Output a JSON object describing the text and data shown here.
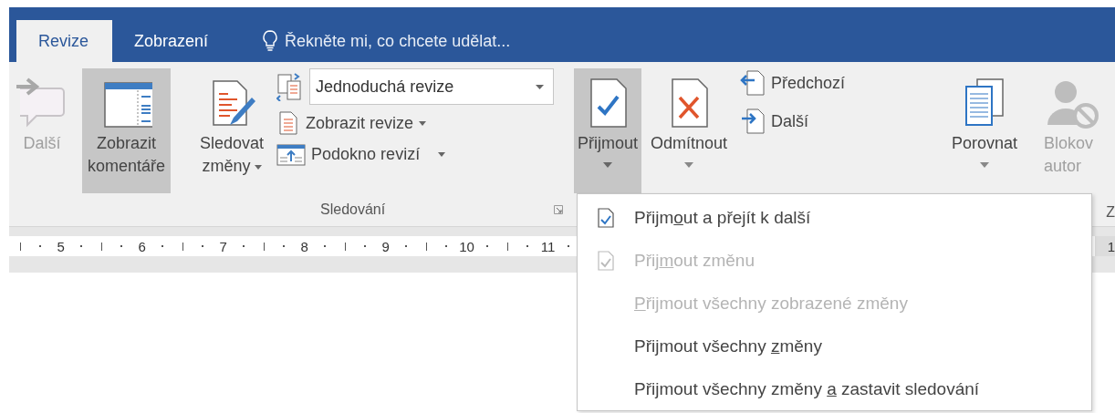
{
  "tabs": [
    {
      "label": "Revize",
      "selected": true
    },
    {
      "label": "Zobrazení",
      "selected": false
    }
  ],
  "tell_me": {
    "placeholder": "Řekněte mi, co chcete udělat..."
  },
  "ribbon": {
    "next_comment": {
      "label": "Další",
      "disabled": true
    },
    "show_comments": {
      "label_lines": [
        "Zobrazit",
        "komentáře"
      ],
      "selected": true
    },
    "track_changes": {
      "label_lines": [
        "Sledovat",
        "změny"
      ]
    },
    "markup_combo": {
      "value": "Jednoduchá revize"
    },
    "show_markup": {
      "label": "Zobrazit revize"
    },
    "reviewing_pane": {
      "label": "Podokno revizí"
    },
    "tracking_group": {
      "label": "Sledování"
    },
    "accept": {
      "label": "Přijmout",
      "selected": true
    },
    "reject": {
      "label": "Odmítnout",
      "selected": false
    },
    "previous": {
      "label": "Předchozí"
    },
    "next": {
      "label": "Další"
    },
    "compare": {
      "label": "Porovnat"
    },
    "block_authors": {
      "label_lines": [
        "Blokov",
        "autor"
      ],
      "disabled": true
    },
    "cut_group": {
      "label": "Z"
    }
  },
  "ruler": {
    "numbers": [
      "5",
      "6",
      "7",
      "8",
      "9",
      "10",
      "11"
    ],
    "cut_number": "1"
  },
  "accept_menu": [
    {
      "parts": [
        "Přijm",
        "o",
        "ut a přejít k další"
      ],
      "disabled": false,
      "kind": "check"
    },
    {
      "parts": [
        "Přij",
        "m",
        "out změnu"
      ],
      "disabled": true,
      "kind": "check"
    },
    {
      "parts": [
        "P",
        "řijmout všechny zobrazené změny"
      ],
      "key_first": true,
      "disabled": true,
      "kind": "plain"
    },
    {
      "parts": [
        "Přijmout všechny ",
        "z",
        "měny"
      ],
      "disabled": false,
      "kind": "plain"
    },
    {
      "parts": [
        "Přijmout všechny změny ",
        "a",
        " zastavit sledování"
      ],
      "disabled": false,
      "kind": "plain"
    }
  ]
}
